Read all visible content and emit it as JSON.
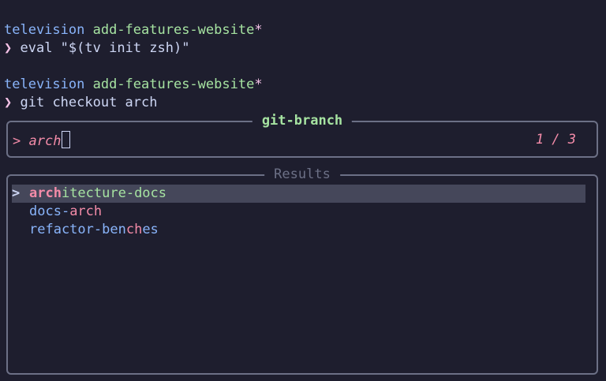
{
  "terminal": {
    "lines": [
      {
        "dir": "television",
        "branch": "add-features-website",
        "dirty": "*"
      },
      {
        "prompt": "❯",
        "command": "eval \"$(tv init zsh)\""
      },
      {
        "dir": "television",
        "branch": "add-features-website",
        "dirty": "*"
      },
      {
        "prompt": "❯",
        "command": "git checkout arch"
      }
    ]
  },
  "picker": {
    "title": "git-branch",
    "prompt_symbol": ">",
    "query": "arch",
    "match_count": "1 / 3",
    "results_title": "Results",
    "selected_marker": ">",
    "results": [
      {
        "pre": "",
        "match": "arch",
        "post": "itecture-docs",
        "selected": true
      },
      {
        "pre": "docs-",
        "match": "arch",
        "post": "",
        "selected": false
      },
      {
        "pre": "refactor-ben",
        "match": "ch",
        "post": "es",
        "selected": false
      }
    ]
  },
  "colors": {
    "background": "#1e1e2e",
    "directory": "#89b4fa",
    "branch": "#a6e3a1",
    "prompt": "#f5c2e7",
    "match_highlight": "#f38ba8",
    "border": "#6c7086",
    "selection_bg": "#45475a"
  }
}
